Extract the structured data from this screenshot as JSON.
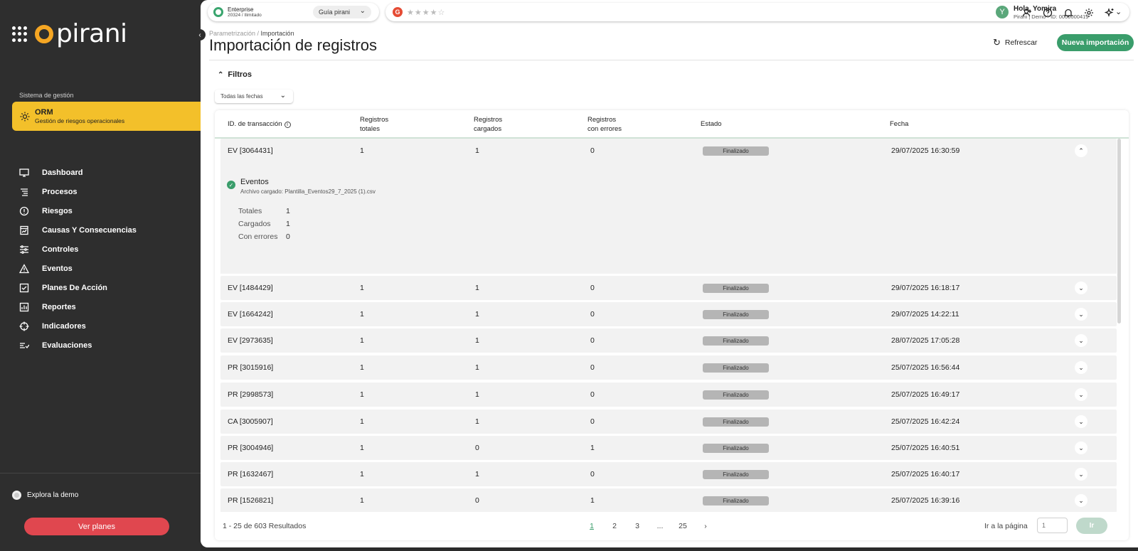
{
  "sidebar": {
    "logo_text": "pirani",
    "system_label": "Sistema de gestión",
    "module": {
      "title": "ORM",
      "subtitle": "Gestión de riesgos operacionales"
    },
    "nav": [
      {
        "label": "Dashboard",
        "icon": "monitor-icon"
      },
      {
        "label": "Procesos",
        "icon": "list-icon"
      },
      {
        "label": "Riesgos",
        "icon": "alert-circle-icon"
      },
      {
        "label": "Causas Y Consecuencias",
        "icon": "chart-doc-icon"
      },
      {
        "label": "Controles",
        "icon": "sliders-icon"
      },
      {
        "label": "Eventos",
        "icon": "warning-triangle-icon"
      },
      {
        "label": "Planes De Acción",
        "icon": "checkbox-icon"
      },
      {
        "label": "Reportes",
        "icon": "report-icon"
      },
      {
        "label": "Indicadores",
        "icon": "target-icon"
      },
      {
        "label": "Evaluaciones",
        "icon": "evaluation-icon"
      }
    ],
    "explore_demo": "Explora la demo",
    "plans_button": "Ver planes"
  },
  "topbar": {
    "plan_title": "Enterprise",
    "plan_sub": "20324 / Ilimitado",
    "guide_label": "Guía pirani",
    "stars": "★★★★☆",
    "user_greeting": "Hola, Yomira",
    "user_sub": "Pirani | Demo • ID: 0000000419",
    "avatar_letter": "Y"
  },
  "header": {
    "breadcrumb_parent": "Parametrización",
    "breadcrumb_sep": " / ",
    "breadcrumb_current": "Importación",
    "title": "Importación de registros",
    "refresh_label": "Refrescar",
    "new_import_label": "Nueva importación"
  },
  "filters": {
    "toggle_label": "Filtros",
    "date_filter": "Todas las fechas"
  },
  "table": {
    "columns": {
      "id": "ID. de transacción",
      "total_1": "Registros",
      "total_2": "totales",
      "loaded_1": "Registros",
      "loaded_2": "cargados",
      "errors_1": "Registros",
      "errors_2": "con errores",
      "status": "Estado",
      "date": "Fecha"
    },
    "rows": [
      {
        "id": "EV [3064431]",
        "total": "1",
        "loaded": "1",
        "errors": "0",
        "status": "Finalizado",
        "date": "29/07/2025 16:30:59",
        "expanded": true
      },
      {
        "id": "EV [1484429]",
        "total": "1",
        "loaded": "1",
        "errors": "0",
        "status": "Finalizado",
        "date": "29/07/2025 16:18:17"
      },
      {
        "id": "EV [1664242]",
        "total": "1",
        "loaded": "1",
        "errors": "0",
        "status": "Finalizado",
        "date": "29/07/2025 14:22:11"
      },
      {
        "id": "EV [2973635]",
        "total": "1",
        "loaded": "1",
        "errors": "0",
        "status": "Finalizado",
        "date": "28/07/2025 17:05:28"
      },
      {
        "id": "PR [3015916]",
        "total": "1",
        "loaded": "1",
        "errors": "0",
        "status": "Finalizado",
        "date": "25/07/2025 16:56:44"
      },
      {
        "id": "PR [2998573]",
        "total": "1",
        "loaded": "1",
        "errors": "0",
        "status": "Finalizado",
        "date": "25/07/2025 16:49:17"
      },
      {
        "id": "CA [3005907]",
        "total": "1",
        "loaded": "1",
        "errors": "0",
        "status": "Finalizado",
        "date": "25/07/2025 16:42:24"
      },
      {
        "id": "PR [3004946]",
        "total": "1",
        "loaded": "0",
        "errors": "1",
        "status": "Finalizado",
        "date": "25/07/2025 16:40:51"
      },
      {
        "id": "PR [1632467]",
        "total": "1",
        "loaded": "1",
        "errors": "0",
        "status": "Finalizado",
        "date": "25/07/2025 16:40:17"
      },
      {
        "id": "PR [1526821]",
        "total": "1",
        "loaded": "0",
        "errors": "1",
        "status": "Finalizado",
        "date": "25/07/2025 16:39:16"
      }
    ],
    "detail": {
      "title": "Eventos",
      "file": "Archivo cargado: Plantilla_Eventos29_7_2025 (1).csv",
      "stats": [
        {
          "label": "Totales",
          "value": "1"
        },
        {
          "label": "Cargados",
          "value": "1"
        },
        {
          "label": "Con errores",
          "value": "0"
        }
      ]
    }
  },
  "footer": {
    "results": "1 - 25 de 603 Resultados",
    "pages": [
      "1",
      "2",
      "3",
      "...",
      "25"
    ],
    "next": "›",
    "goto_label": "Ir a la página",
    "goto_placeholder": "1",
    "goto_button": "Ir"
  },
  "colors": {
    "brand_orange": "#f5a623",
    "module_yellow": "#f3c02a",
    "accent_green": "#3a9d6b",
    "plans_red": "#e0474f",
    "sidebar_bg": "#2e2e2e"
  }
}
